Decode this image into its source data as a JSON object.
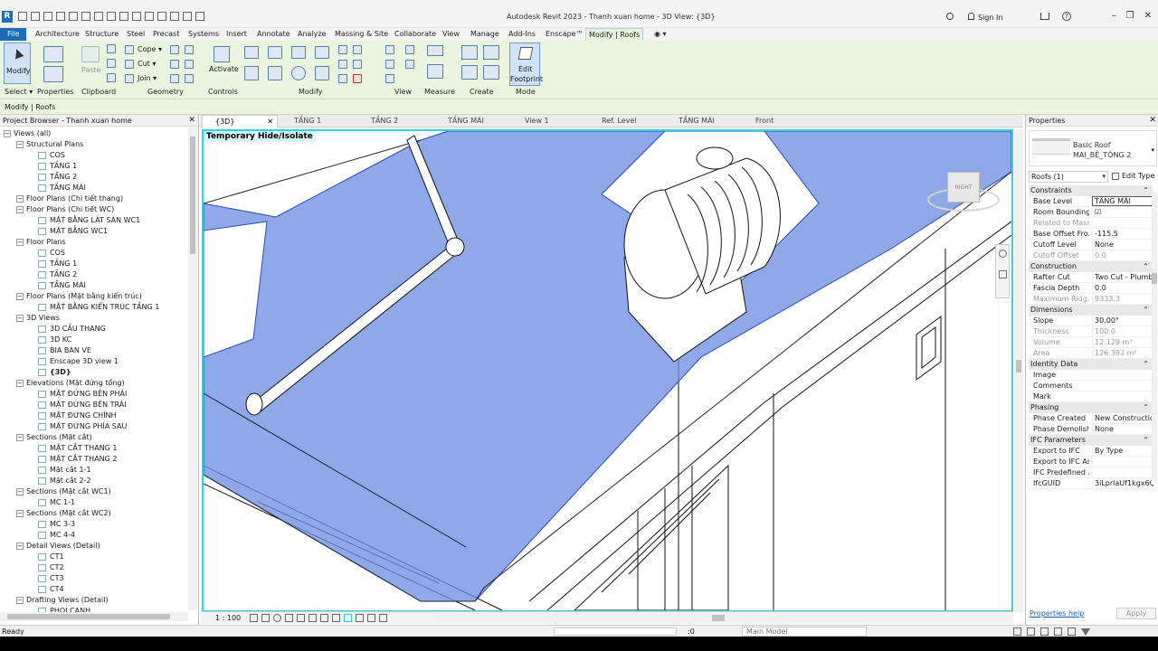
{
  "app": {
    "title": "Autodesk Revit 2023 - Thanh xuan home - 3D View: {3D}",
    "sign_in": "Sign In",
    "logo": "R"
  },
  "menu": {
    "file": "File",
    "tabs": [
      "Architecture",
      "Structure",
      "Steel",
      "Precast",
      "Systems",
      "Insert",
      "Annotate",
      "Analyze",
      "Massing & Site",
      "Collaborate",
      "View",
      "Manage",
      "Add-Ins",
      "Enscape™",
      "Modify | Roofs"
    ]
  },
  "ribbon": {
    "modify": "Modify",
    "select": "Select ▾",
    "properties": "Properties",
    "paste": "Paste",
    "clipboard": "Clipboard",
    "cope": "Cope ▾",
    "cut": "Cut ▾",
    "join": "Join ▾",
    "geometry": "Geometry",
    "activate": "Activate",
    "controls": "Controls",
    "modify_group": "Modify",
    "view_group": "View",
    "measure_group": "Measure",
    "create_group": "Create",
    "edit_footprint": [
      "Edit",
      "Footprint"
    ],
    "mode_group": "Mode"
  },
  "options_bar": {
    "label": "Modify | Roofs"
  },
  "browser": {
    "title": "Project Browser - Thanh xuan home",
    "items": [
      {
        "label": "Views (all)",
        "type": "group"
      },
      {
        "label": "Structural Plans",
        "type": "group"
      },
      {
        "label": "COS",
        "type": "view"
      },
      {
        "label": "TẦNG 1",
        "type": "view"
      },
      {
        "label": "TẦNG 2",
        "type": "view"
      },
      {
        "label": "TẦNG MÁI",
        "type": "view"
      },
      {
        "label": "Floor Plans (Chi tiết thang)",
        "type": "group"
      },
      {
        "label": "Floor Plans (Chi tiết WC)",
        "type": "group"
      },
      {
        "label": "MẶT BẰNG LÁT SÀN WC1",
        "type": "view"
      },
      {
        "label": "MẶT BẰNG WC1",
        "type": "view"
      },
      {
        "label": "Floor Plans",
        "type": "group"
      },
      {
        "label": "COS",
        "type": "view"
      },
      {
        "label": "TẦNG 1",
        "type": "view"
      },
      {
        "label": "TẦNG 2",
        "type": "view"
      },
      {
        "label": "TẦNG MÁI",
        "type": "view"
      },
      {
        "label": "Floor Plans (Mặt bằng kiến trúc)",
        "type": "group"
      },
      {
        "label": "MẶT BẰNG KIẾN TRÚC TẦNG 1",
        "type": "view"
      },
      {
        "label": "3D Views",
        "type": "group"
      },
      {
        "label": "3D CẦU THANG",
        "type": "view"
      },
      {
        "label": "3D KC",
        "type": "view"
      },
      {
        "label": "BIA BAN VE",
        "type": "view"
      },
      {
        "label": "Enscape 3D view 1",
        "type": "view"
      },
      {
        "label": "{3D}",
        "type": "view",
        "bold": true
      },
      {
        "label": "Elevations (Mặt đứng tổng)",
        "type": "group"
      },
      {
        "label": "MẶT ĐỨNG BÊN PHẢI",
        "type": "view"
      },
      {
        "label": "MẶT ĐỨNG BÊN TRÁI",
        "type": "view"
      },
      {
        "label": "MẶT ĐỨNG CHÍNH",
        "type": "view"
      },
      {
        "label": "MẶT ĐỨNG PHÍA SAU",
        "type": "view"
      },
      {
        "label": "Sections (Mặt cắt)",
        "type": "group"
      },
      {
        "label": "MẶT CẮT THANG 1",
        "type": "view"
      },
      {
        "label": "MẶT CẮT THANG 2",
        "type": "view"
      },
      {
        "label": "Mặt cắt 1-1",
        "type": "view"
      },
      {
        "label": "Mặt cắt 2-2",
        "type": "view"
      },
      {
        "label": "Sections (Mặt cắt WC1)",
        "type": "group"
      },
      {
        "label": "MC 1-1",
        "type": "view"
      },
      {
        "label": "Sections (Mặt cắt WC2)",
        "type": "group"
      },
      {
        "label": "MC 3-3",
        "type": "view"
      },
      {
        "label": "MC 4-4",
        "type": "view"
      },
      {
        "label": "Detail Views (Detail)",
        "type": "group"
      },
      {
        "label": "CT1",
        "type": "view"
      },
      {
        "label": "CT2",
        "type": "view"
      },
      {
        "label": "CT3",
        "type": "view"
      },
      {
        "label": "CT4",
        "type": "view"
      },
      {
        "label": "Drafting Views (Detail)",
        "type": "group"
      },
      {
        "label": "PHOI CANH",
        "type": "view"
      }
    ]
  },
  "view_tabs": [
    "{3D}",
    "TẦNG 1",
    "TẦNG 2",
    "TẦNG MÁI",
    "View 1",
    "Ref. Level",
    "TẦNG MÁI",
    "Front"
  ],
  "viewport": {
    "temporary_label": "Temporary Hide/Isolate",
    "scale": "1 : 100",
    "viewcube_label": "RIGHT"
  },
  "properties": {
    "title": "Properties",
    "type_family": "Basic Roof",
    "type_name": "MAI_BÊ_TÔNG 2",
    "selector": "Roofs (1)",
    "edit_type": "Edit Type",
    "rows": [
      {
        "section": "Constraints"
      },
      {
        "label": "Base Level",
        "value": "TẦNG MÁI"
      },
      {
        "label": "Room Bounding",
        "value": "☑"
      },
      {
        "label": "Related to Mass",
        "value": "",
        "grey": true
      },
      {
        "label": "Base Offset Fro...",
        "value": "-115.5"
      },
      {
        "label": "Cutoff Level",
        "value": "None"
      },
      {
        "label": "Cutoff Offset",
        "value": "0.0",
        "grey": true
      },
      {
        "section": "Construction"
      },
      {
        "label": "Rafter Cut",
        "value": "Two Cut - Plumb"
      },
      {
        "label": "Fascia Depth",
        "value": "0.0"
      },
      {
        "label": "Maximum Ridg...",
        "value": "9333.3",
        "grey": true
      },
      {
        "section": "Dimensions"
      },
      {
        "label": "Slope",
        "value": "30.00°"
      },
      {
        "label": "Thickness",
        "value": "100.0",
        "grey": true
      },
      {
        "label": "Volume",
        "value": "12.129 m³",
        "grey": true
      },
      {
        "label": "Area",
        "value": "126.392 m²",
        "grey": true
      },
      {
        "section": "Identity Data"
      },
      {
        "label": "Image",
        "value": ""
      },
      {
        "label": "Comments",
        "value": ""
      },
      {
        "label": "Mark",
        "value": ""
      },
      {
        "section": "Phasing"
      },
      {
        "label": "Phase Created",
        "value": "New Construction"
      },
      {
        "label": "Phase Demolish...",
        "value": "None"
      },
      {
        "section": "IFC Parameters"
      },
      {
        "label": "Export to IFC",
        "value": "By Type"
      },
      {
        "label": "Export to IFC As",
        "value": ""
      },
      {
        "label": "IFC Predefined ...",
        "value": ""
      },
      {
        "label": "IfcGUID",
        "value": "3iLprlaUf1kgx6Q..."
      }
    ],
    "help": "Properties help",
    "apply": "Apply"
  },
  "status": {
    "text": "Ready",
    "zero": ":0",
    "model": "Main Model"
  },
  "colors": {
    "selection": "#2bd3f0",
    "roof_fill": "#8aa4e6",
    "ribbon": "#e9f5df",
    "file_tab": "#1e6bb8"
  }
}
